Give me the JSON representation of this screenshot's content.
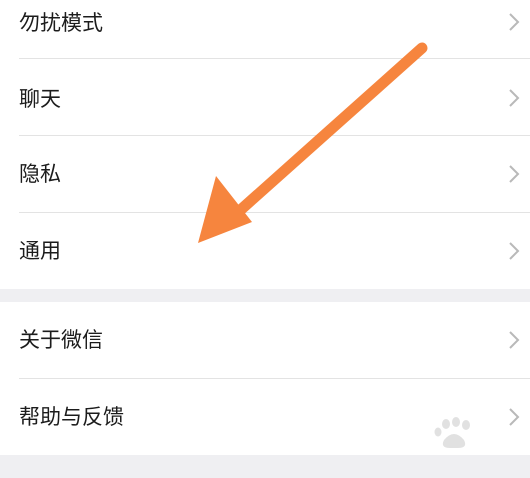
{
  "settings": {
    "group1": [
      {
        "label": "勿扰模式"
      },
      {
        "label": "聊天"
      },
      {
        "label": "隐私"
      },
      {
        "label": "通用"
      }
    ],
    "group2": [
      {
        "label": "关于微信"
      },
      {
        "label": "帮助与反馈"
      }
    ]
  },
  "icons": {
    "chevron": "chevron-right-icon",
    "annotation": "arrow-icon"
  },
  "colors": {
    "arrow": "#f6853e",
    "chevron": "#b9b9b9",
    "background": "#efeff2",
    "text": "#1c1c1c"
  }
}
